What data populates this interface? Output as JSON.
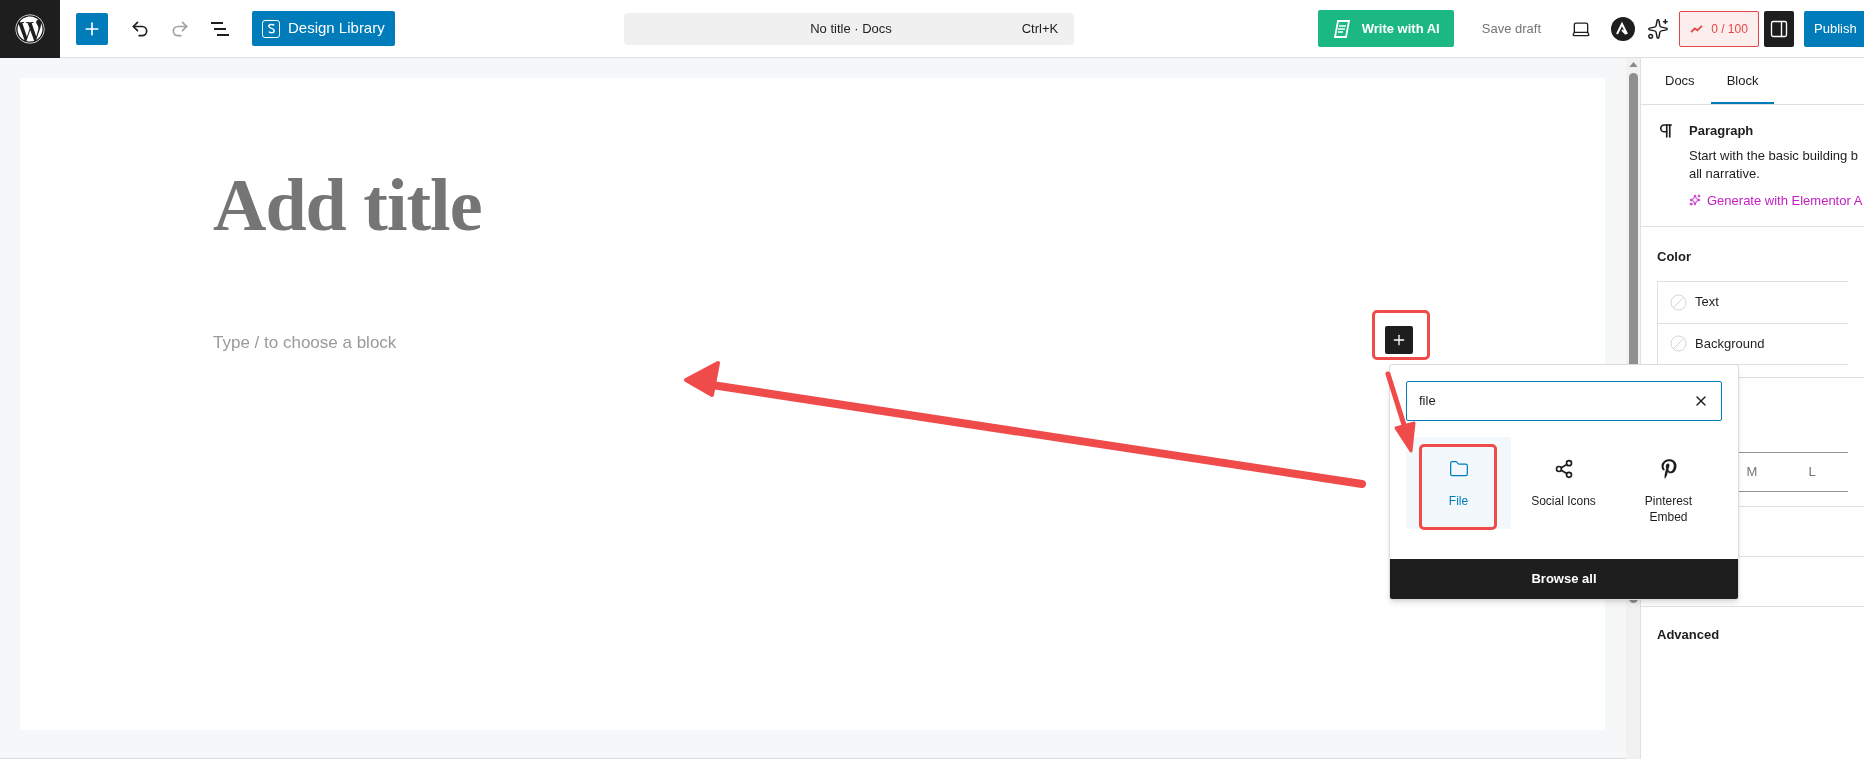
{
  "topbar": {
    "design_library": "Design Library",
    "document": {
      "title": "No title · Docs",
      "shortcut": "Ctrl+K"
    },
    "write_ai": "Write with AI",
    "save_draft": "Save draft",
    "score": "0 / 100",
    "publish": "Publish"
  },
  "editor": {
    "title_placeholder": "Add title",
    "block_placeholder": "Type / to choose a block"
  },
  "inserter": {
    "search_value": "file",
    "results": [
      {
        "label": "File",
        "selected": true,
        "kind": "folder"
      },
      {
        "label": "Social Icons",
        "selected": false,
        "kind": "share"
      },
      {
        "label": "Pinterest Embed",
        "selected": false,
        "kind": "pinterest"
      }
    ],
    "browse_all": "Browse all"
  },
  "sidebar": {
    "tabs": [
      {
        "label": "Docs",
        "selected": false
      },
      {
        "label": "Block",
        "selected": true
      }
    ],
    "block": {
      "name": "Paragraph",
      "description_lines": [
        "Start with the basic building b",
        "all narrative."
      ],
      "ai_link": "Generate with Elementor A"
    },
    "color": {
      "heading": "Color",
      "items": [
        "Text",
        "Background"
      ]
    },
    "size_options": [
      "M",
      "L"
    ],
    "advanced": "Advanced"
  }
}
